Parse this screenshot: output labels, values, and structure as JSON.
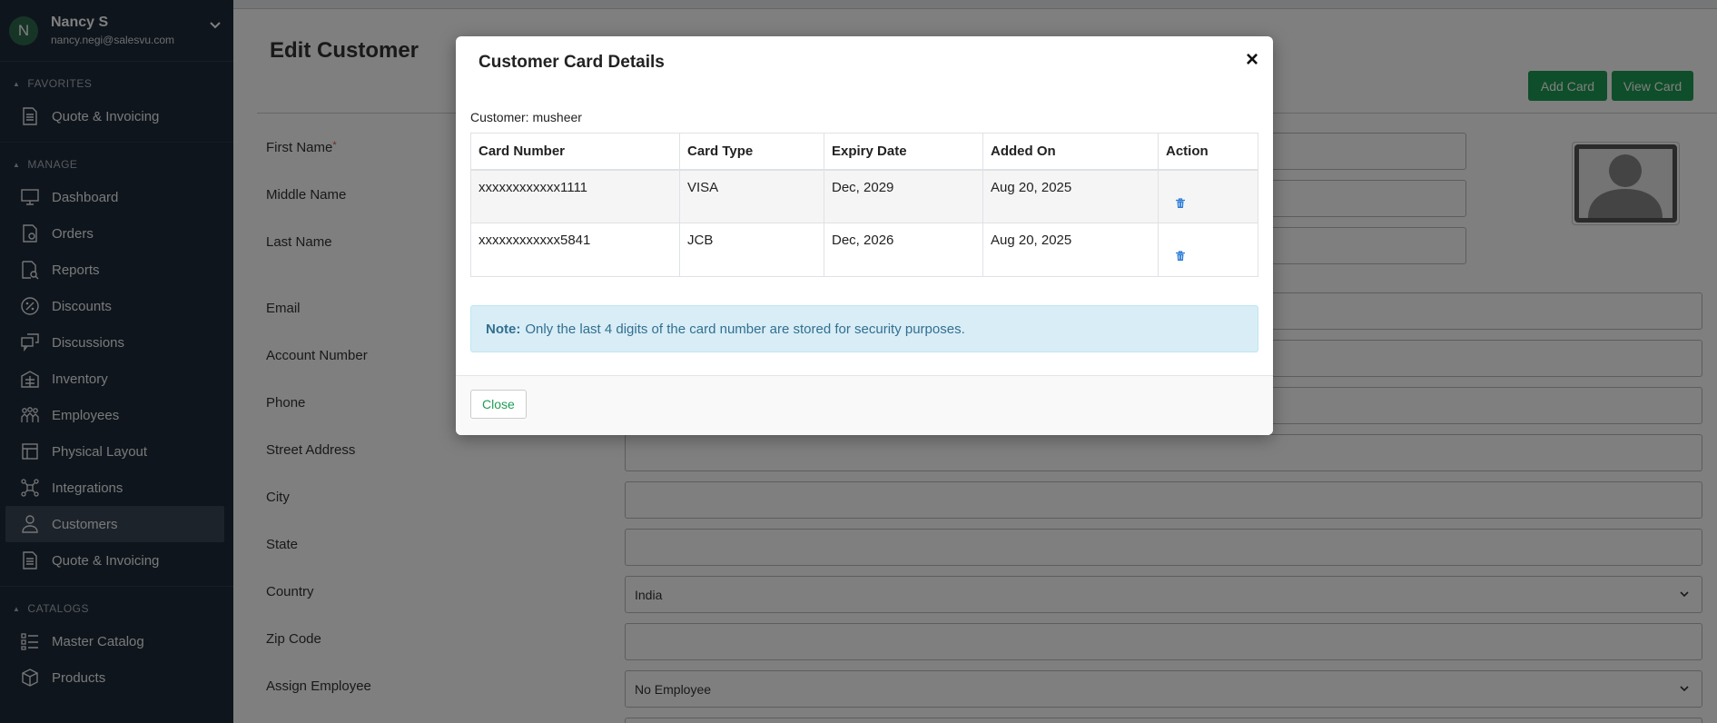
{
  "user": {
    "initial": "N",
    "name": "Nancy S",
    "email": "nancy.negi@salesvu.com"
  },
  "sidebar": {
    "favorites_label": "FAVORITES",
    "favorites": [
      {
        "label": "Quote & Invoicing",
        "icon": "invoice-icon"
      }
    ],
    "manage_label": "MANAGE",
    "manage": [
      {
        "label": "Dashboard",
        "icon": "monitor-icon"
      },
      {
        "label": "Orders",
        "icon": "orders-icon"
      },
      {
        "label": "Reports",
        "icon": "reports-icon"
      },
      {
        "label": "Discounts",
        "icon": "percent-icon"
      },
      {
        "label": "Discussions",
        "icon": "chat-icon"
      },
      {
        "label": "Inventory",
        "icon": "inventory-icon"
      },
      {
        "label": "Employees",
        "icon": "employees-icon"
      },
      {
        "label": "Physical Layout",
        "icon": "layout-icon"
      },
      {
        "label": "Integrations",
        "icon": "integrations-icon"
      },
      {
        "label": "Customers",
        "icon": "customer-icon",
        "active": true
      },
      {
        "label": "Quote & Invoicing",
        "icon": "invoice-icon"
      }
    ],
    "catalogs_label": "CATALOGS",
    "catalogs": [
      {
        "label": "Master Catalog",
        "icon": "catalog-icon"
      },
      {
        "label": "Products",
        "icon": "box-icon"
      }
    ]
  },
  "page": {
    "title": "Edit Customer",
    "add_card": "Add Card",
    "view_card": "View Card",
    "labels": {
      "first_name": "First Name",
      "required": "*",
      "middle_name": "Middle Name",
      "last_name": "Last Name",
      "email": "Email",
      "account_number": "Account Number",
      "phone": "Phone",
      "street_address": "Street Address",
      "city": "City",
      "state": "State",
      "country": "Country",
      "zip_code": "Zip Code",
      "assign_employee": "Assign Employee"
    },
    "values": {
      "country": "India",
      "assign_employee": "No Employee"
    }
  },
  "modal": {
    "title": "Customer Card Details",
    "close_x": "×",
    "customer_line": "Customer: musheer",
    "columns": [
      "Card Number",
      "Card Type",
      "Expiry Date",
      "Added On",
      "Action"
    ],
    "rows": [
      {
        "card_number": "xxxxxxxxxxxx1111",
        "card_type": "VISA",
        "expiry": "Dec, 2029",
        "added_on": "Aug 20, 2025"
      },
      {
        "card_number": "xxxxxxxxxxxx5841",
        "card_type": "JCB",
        "expiry": "Dec, 2026",
        "added_on": "Aug 20, 2025"
      }
    ],
    "note_label": "Note:",
    "note_text": "Only the last 4 digits of the card number are stored for security purposes.",
    "close_button": "Close"
  },
  "colors": {
    "sidebar_bg": "#1e2a38",
    "accent_green": "#1f9d55",
    "note_bg": "#d9edf7",
    "note_text": "#31708f",
    "trash_blue": "#2b7bd6"
  }
}
